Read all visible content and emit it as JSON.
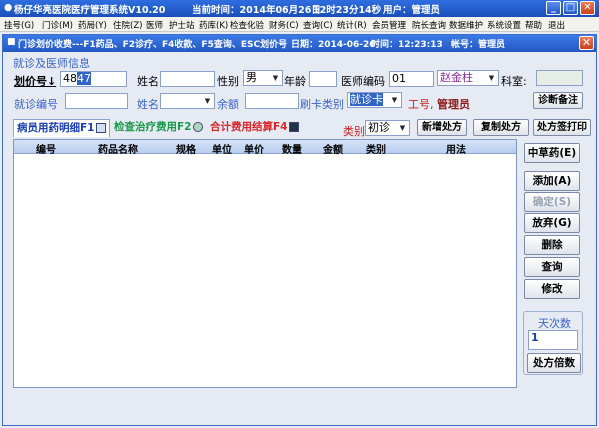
{
  "window": {
    "title": "杨仔华亮医院医疗管理系统V10.20",
    "time_label": "当前时间：2014年06月26日",
    "clock": "12时23分14秒",
    "user": "用户：管理员",
    "min": "_",
    "max": "□",
    "close": "✕"
  },
  "menu": [
    "挂号(G)",
    "门诊(M)",
    "药局(Y)",
    "住院(Z)",
    "医师",
    "护士站",
    "药库(K)",
    "检查化验",
    "财务(C)",
    "查询(C)",
    "统计(R)",
    "会员管理",
    "院长查询",
    "数据维护",
    "系统设置",
    "帮助",
    "退出"
  ],
  "inner": {
    "title": "门诊划价收费---F1药品、F2诊疗、F4收款、F5查询、ESC划价号",
    "date": "日期：2014-06-26",
    "time": "时间：12:23:13",
    "account": "帐号：管理员",
    "close": "✕"
  },
  "group_title": "就诊及医师信息",
  "form": {
    "serial_label": "划价号↓",
    "serial_prefix": "48",
    "serial_selected": "47",
    "name_label": "姓名",
    "name_value": "",
    "gender_label": "性别",
    "gender_value": "男",
    "age_label": "年龄",
    "age_value": "",
    "doctor_code_label": "医师编码",
    "doctor_code_value": "01",
    "doctor_name": "赵金柱",
    "dept_label": "科室:",
    "dept_value": "",
    "visit_no_label": "就诊编号",
    "visit_no_value": "",
    "name2_label": "姓名",
    "name2_value": "",
    "balance_label": "余额",
    "balance_value": "",
    "card_type_label": "刷卡类别",
    "card_type_value": "就诊卡",
    "job_id_label": "工号,",
    "job_id_value": "管理员",
    "note_button": "诊断备注"
  },
  "tabs": [
    {
      "label": "病员用药明细F1",
      "color": "#1a3fb0"
    },
    {
      "label": "检查治疗费用F2",
      "color": "#1a9a4a"
    },
    {
      "label": "合计费用结算F4",
      "color": "#d8262a"
    }
  ],
  "category_label": "类别",
  "category_value": "初诊",
  "toolbar": {
    "new": "新增处方",
    "copy": "复制处方",
    "print": "处方签打印"
  },
  "grid_columns": [
    "编号",
    "药品名称",
    "规格",
    "单位",
    "单价",
    "数量",
    "金额",
    "类别",
    "用法"
  ],
  "side": {
    "herbal": "中草药(E)",
    "add": "添加(A)",
    "confirm": "确定(S)",
    "discard": "放弃(G)",
    "delete": "删除",
    "query": "查询",
    "modify": "修改",
    "days_label": "天次数",
    "days_value": "1",
    "multiplier": "处方倍数"
  }
}
